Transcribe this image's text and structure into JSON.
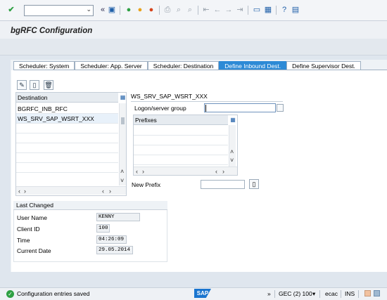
{
  "toolbar": {
    "icons": [
      "checkmark-icon",
      "command-field",
      "back-arrows-icon",
      "save-icon",
      "back-icon",
      "exit-icon",
      "cancel-icon",
      "print-icon",
      "find-icon",
      "find-next-icon",
      "first-page-icon",
      "previous-page-icon",
      "next-page-icon",
      "last-page-icon",
      "create-session-icon",
      "shortcut-icon",
      "help-icon",
      "customize-layout-icon"
    ]
  },
  "title": "bgRFC Configuration",
  "tabs": [
    {
      "label": "Scheduler: System"
    },
    {
      "label": "Scheduler: App. Server"
    },
    {
      "label": "Scheduler: Destination"
    },
    {
      "label": "Define Inbound Dest."
    },
    {
      "label": "Define Supervisor Dest."
    }
  ],
  "destination_table": {
    "header": "Destination",
    "rows": [
      "BGRFC_INB_RFC",
      "WS_SRV_SAP_WSRT_XXX"
    ]
  },
  "detail": {
    "heading": "WS_SRV_SAP_WSRT_XXX",
    "logon_label": "Logon/server group",
    "logon_value": "",
    "prefixes_header": "Prefixes",
    "new_prefix_label": "New Prefix",
    "new_prefix_value": ""
  },
  "last_changed": {
    "heading": "Last Changed",
    "user_name_label": "User Name",
    "user_name": "KENNY",
    "client_id_label": "Client ID",
    "client_id": "100",
    "time_label": "Time",
    "time": "04:26:09",
    "current_date_label": "Current Date",
    "current_date": "29.05.2014"
  },
  "status": {
    "message": "Configuration entries saved",
    "logo": "SAP",
    "system": "GEC (2) 100",
    "host": "ecac",
    "mode": "INS"
  }
}
